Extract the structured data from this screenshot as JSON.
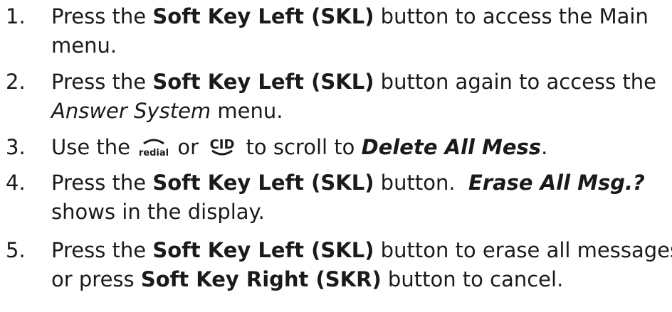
{
  "steps": [
    {
      "number": "1.",
      "line1_a": "Press the ",
      "line1_b": "Soft Key Left (SKL)",
      "line1_c": " button to access the Main",
      "line2": "menu."
    },
    {
      "number": "2.",
      "line1_a": "Press the ",
      "line1_b": "Soft Key Left (SKL)",
      "line1_c": " button again to access the",
      "line2_a": "Answer System",
      "line2_b": " menu."
    },
    {
      "number": "3.",
      "part_a": "Use the ",
      "icon_redial": "redial",
      "part_b": " or ",
      "icon_cid": "CID",
      "part_c": " to scroll to ",
      "part_d": "Delete All Mess",
      "part_e": "."
    },
    {
      "number": "4.",
      "line1_a": "Press the ",
      "line1_b": "Soft Key Left (SKL)",
      "line1_c": " button.  ",
      "line1_d": "Erase All Msg.?",
      "line2": "shows in the display."
    },
    {
      "number": "5.",
      "line1_a": "Press the ",
      "line1_b": "Soft Key Left (SKL)",
      "line1_c": " button to erase all messages",
      "line2_a": "or press ",
      "line2_b": "Soft Key Right (SKR)",
      "line2_c": " button to cancel."
    }
  ]
}
